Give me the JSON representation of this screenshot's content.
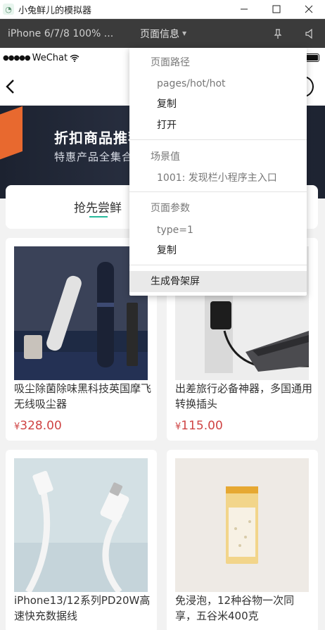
{
  "window": {
    "title": "小兔鲜儿的模拟器",
    "icons": [
      "minimize-icon",
      "maximize-icon",
      "close-icon"
    ]
  },
  "toolbar": {
    "device": "iPhone 6/7/8 100% ...",
    "page_info_label": "页面信息",
    "icons": [
      "chevron-down-icon",
      "pin-icon",
      "speaker-icon"
    ]
  },
  "status_bar": {
    "signal": "●●●●●",
    "carrier": "WeChat"
  },
  "banner": {
    "title": "折扣商品推荐",
    "subtitle": "特惠产品全集合"
  },
  "tabs": [
    {
      "label": "抢先尝鲜",
      "active": true
    }
  ],
  "products": [
    {
      "name": "吸尘除菌除味黑科技英国摩飞无线吸尘器",
      "price_symbol": "¥",
      "price": "328.00"
    },
    {
      "name": "出差旅行必备神器，多国通用转换插头",
      "price_symbol": "¥",
      "price": "115.00"
    },
    {
      "name": "iPhone13/12系列PD20W高速快充数据线",
      "price_symbol": "",
      "price": ""
    },
    {
      "name": "免浸泡，12种谷物一次同享，五谷米400克",
      "price_symbol": "",
      "price": ""
    }
  ],
  "dropdown": {
    "page_path_label": "页面路径",
    "page_path_value": "pages/hot/hot",
    "copy_label": "复制",
    "open_label": "打开",
    "scene_label": "场景值",
    "scene_value": "1001: 发现栏小程序主入口",
    "params_label": "页面参数",
    "params_value": "type=1",
    "copy_label_2": "复制",
    "skeleton_label": "生成骨架屏"
  },
  "colors": {
    "accent": "#27ba9b",
    "price": "#cf4444",
    "toolbar_bg": "#3b3b3b"
  }
}
